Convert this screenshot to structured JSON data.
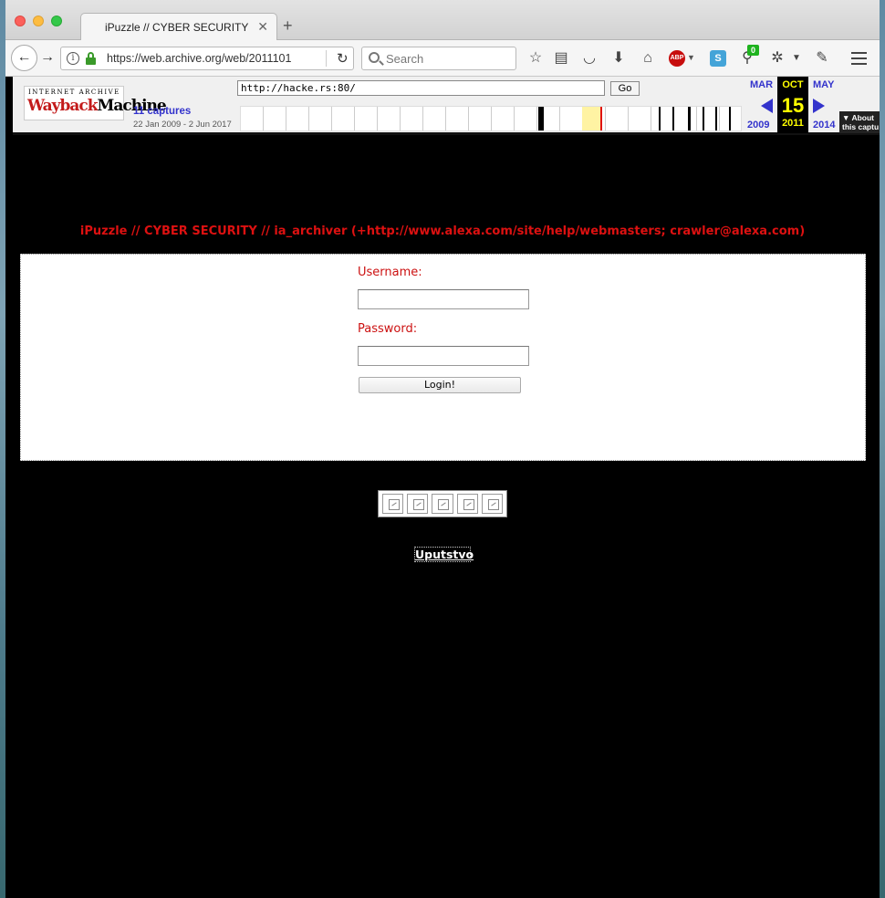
{
  "browser": {
    "tab_title": "iPuzzle // CYBER SECURITY",
    "tab_close": "✕",
    "new_tab": "+",
    "url": "https://web.archive.org/web/2011101",
    "search_placeholder": "Search",
    "addon_badge": "0",
    "abp_label": "ABP",
    "skype_label": "S"
  },
  "wayback": {
    "logo_top": "INTERNET ARCHIVE",
    "logo_main_red": "Wayback",
    "logo_main_black": "Machine",
    "input_url": "http://hacke.rs:80/",
    "go_label": "Go",
    "captures": "11 captures",
    "date_range": "22 Jan 2009 - 2 Jun 2017",
    "prev_month": "MAR",
    "prev_year": "2009",
    "cur_month": "OCT",
    "cur_day": "15",
    "cur_year": "2011",
    "next_month": "MAY",
    "next_year": "2014",
    "about_line1": "▼ About",
    "about_line2": "this captu"
  },
  "page": {
    "title": "iPuzzle // CYBER SECURITY // ia_archiver (+http://www.alexa.com/site/help/webmasters; crawler@alexa.com)",
    "username_label": "Username:",
    "password_label": "Password:",
    "login_button": "Login!",
    "help_link": "Uputstvo"
  },
  "colors": {
    "title_red": "#dd1111",
    "label_red": "#cc1111",
    "wayback_blue": "#3333cc",
    "calendar_yellow": "#ffff00"
  }
}
